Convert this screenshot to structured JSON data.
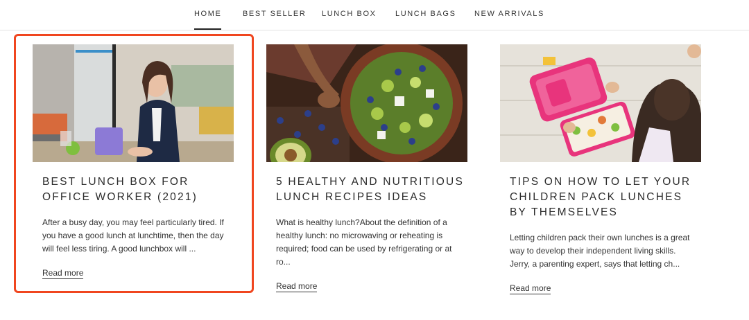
{
  "nav": {
    "items": [
      {
        "label": "HOME",
        "active": true
      },
      {
        "label": "BEST SELLER",
        "active": false
      },
      {
        "label": "LUNCH BOX",
        "active": false
      },
      {
        "label": "LUNCH BAGS",
        "active": false
      },
      {
        "label": "NEW ARRIVALS",
        "active": false
      }
    ]
  },
  "posts": [
    {
      "title": "BEST LUNCH BOX FOR OFFICE WORKER (2021)",
      "excerpt": "After a busy day, you may feel particularly tired. If you have a good lunch at lunchtime, then the day will feel less tiring. A good lunchbox will ...",
      "read_more": "Read more",
      "highlighted": true
    },
    {
      "title": "5 HEALTHY AND NUTRITIOUS LUNCH RECIPES IDEAS",
      "excerpt": "What is healthy lunch?About the definition of a healthy lunch: no microwaving or reheating is required; food can be used by refrigerating or at ro...",
      "read_more": "Read more",
      "highlighted": false
    },
    {
      "title": "TIPS ON HOW TO LET YOUR CHILDREN PACK LUNCHES BY THEMSELVES",
      "excerpt": "Letting children pack their own lunches is a great way to develop their independent living skills. Jerry, a parenting expert, says that letting ch...",
      "read_more": "Read more",
      "highlighted": false
    }
  ],
  "colors": {
    "highlight_border": "#f0461f",
    "text": "#2b2b2b",
    "nav_divider": "#e3e3e3"
  }
}
